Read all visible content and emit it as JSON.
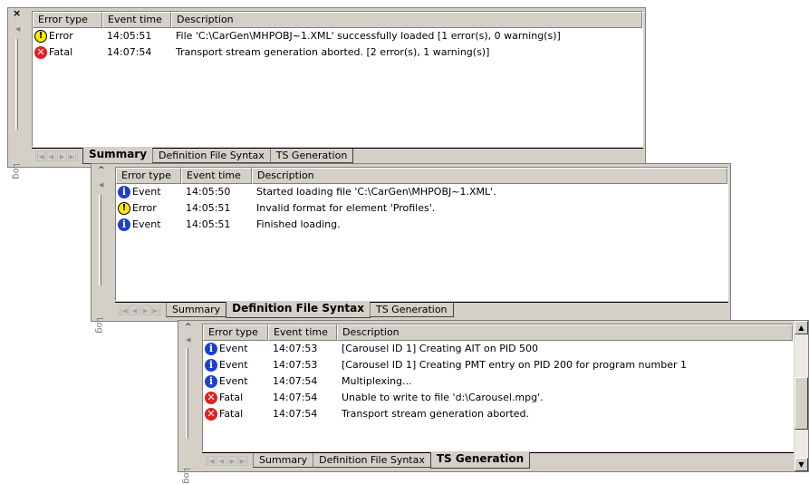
{
  "columns": {
    "type": "Error type",
    "time": "Event time",
    "desc": "Description"
  },
  "gutter": {
    "close": "×",
    "caret": "^",
    "log": "Log"
  },
  "nav": {
    "first": "|◀",
    "prev": "◀",
    "next": "▶",
    "last": "▶|"
  },
  "tabs": {
    "summary": "Summary",
    "syntax": "Definition File Syntax",
    "ts": "TS Generation"
  },
  "panels": {
    "summary": {
      "active_tab": "summary",
      "rows": [
        {
          "icon": "warning-icon",
          "type": "Error",
          "time": "14:05:51",
          "desc": "File 'C:\\CarGen\\MHPOBJ~1.XML' successfully loaded [1 error(s), 0 warning(s)]"
        },
        {
          "icon": "fatal-icon",
          "type": "Fatal",
          "time": "14:07:54",
          "desc": "Transport stream generation aborted. [2 error(s), 1 warning(s)]"
        }
      ]
    },
    "syntax": {
      "active_tab": "syntax",
      "rows": [
        {
          "icon": "info-icon",
          "type": "Event",
          "time": "14:05:50",
          "desc": "Started loading file 'C:\\CarGen\\MHPOBJ~1.XML'."
        },
        {
          "icon": "warning-icon",
          "type": "Error",
          "time": "14:05:51",
          "desc": "Invalid format for element 'Profiles'."
        },
        {
          "icon": "info-icon",
          "type": "Event",
          "time": "14:05:51",
          "desc": "Finished loading."
        }
      ]
    },
    "ts": {
      "active_tab": "ts",
      "rows": [
        {
          "icon": "info-icon",
          "type": "Event",
          "time": "14:07:53",
          "desc": "[Carousel ID 1] Creating AIT on PID 500"
        },
        {
          "icon": "info-icon",
          "type": "Event",
          "time": "14:07:53",
          "desc": "[Carousel ID 1] Creating PMT entry on PID 200 for program number 1"
        },
        {
          "icon": "info-icon",
          "type": "Event",
          "time": "14:07:54",
          "desc": "Multiplexing..."
        },
        {
          "icon": "fatal-icon",
          "type": "Fatal",
          "time": "14:07:54",
          "desc": "Unable to write to file 'd:\\Carousel.mpg'."
        },
        {
          "icon": "fatal-icon",
          "type": "Fatal",
          "time": "14:07:54",
          "desc": "Transport stream generation aborted."
        }
      ]
    }
  },
  "colors": {
    "info": "#1f3fd0",
    "warning": "#ffea00",
    "fatal": "#e02020",
    "face": "#d4d0c8"
  }
}
